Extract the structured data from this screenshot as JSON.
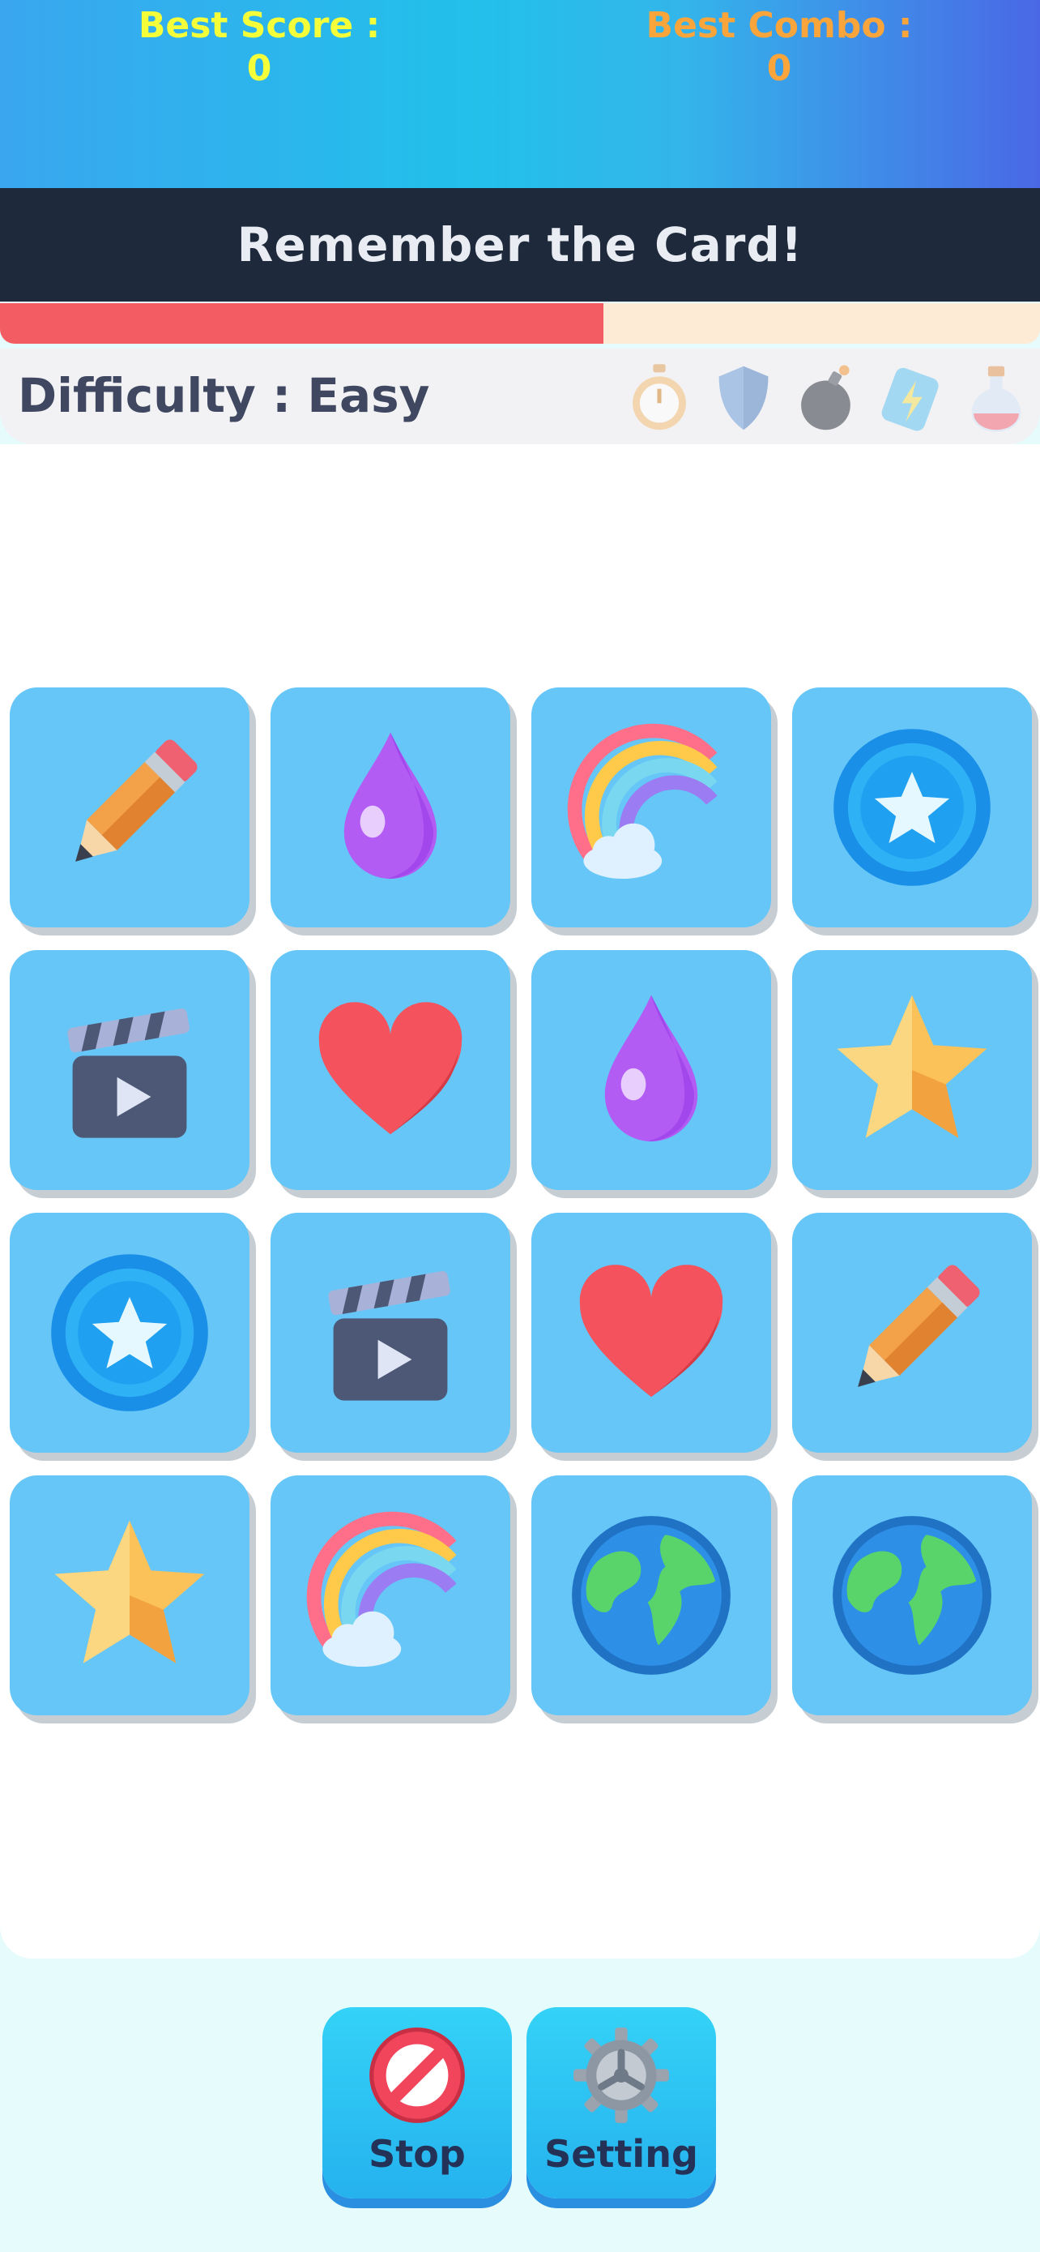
{
  "header": {
    "best_score_label": "Best Score :",
    "best_score_value": "0",
    "best_combo_label": "Best Combo :",
    "best_combo_value": "0"
  },
  "banner": {
    "text": "Remember the Card!"
  },
  "timer": {
    "fraction_remaining": 0.58
  },
  "difficulty": {
    "label": "Difficulty : Easy"
  },
  "powerups": [
    "stopwatch-icon",
    "shield-icon",
    "bomb-icon",
    "lightning-card-icon",
    "potion-icon"
  ],
  "board": {
    "rows": 4,
    "cols": 4,
    "cards": [
      "pencil",
      "drop",
      "rainbow",
      "star-coin",
      "clapper",
      "heart",
      "drop",
      "star",
      "star-coin",
      "clapper",
      "heart",
      "pencil",
      "star",
      "rainbow",
      "earth",
      "earth"
    ]
  },
  "buttons": {
    "stop_label": "Stop",
    "setting_label": "Setting"
  },
  "colors": {
    "card_bg": "#65c6f7",
    "timer_fill": "#f25c62",
    "timer_track": "#fdebd5",
    "banner_bg": "#1e293c"
  }
}
